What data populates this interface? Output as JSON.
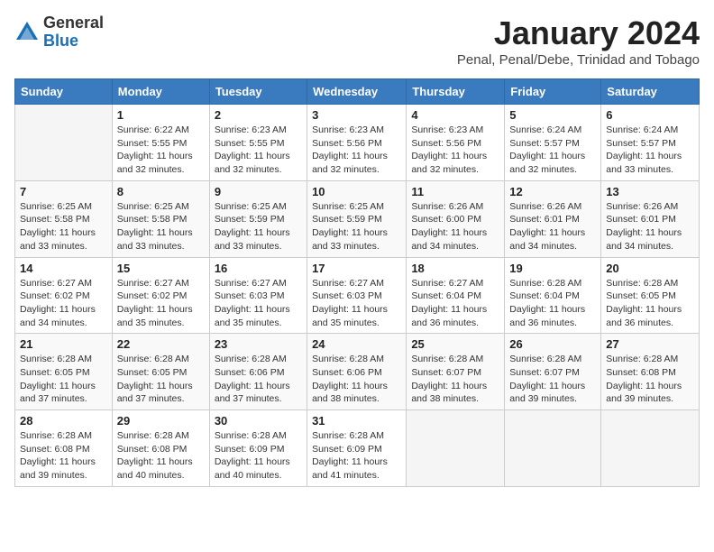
{
  "header": {
    "logo_general": "General",
    "logo_blue": "Blue",
    "month_title": "January 2024",
    "subtitle": "Penal, Penal/Debe, Trinidad and Tobago"
  },
  "days_of_week": [
    "Sunday",
    "Monday",
    "Tuesday",
    "Wednesday",
    "Thursday",
    "Friday",
    "Saturday"
  ],
  "weeks": [
    [
      {
        "day": "",
        "info": ""
      },
      {
        "day": "1",
        "info": "Sunrise: 6:22 AM\nSunset: 5:55 PM\nDaylight: 11 hours and 32 minutes."
      },
      {
        "day": "2",
        "info": "Sunrise: 6:23 AM\nSunset: 5:55 PM\nDaylight: 11 hours and 32 minutes."
      },
      {
        "day": "3",
        "info": "Sunrise: 6:23 AM\nSunset: 5:56 PM\nDaylight: 11 hours and 32 minutes."
      },
      {
        "day": "4",
        "info": "Sunrise: 6:23 AM\nSunset: 5:56 PM\nDaylight: 11 hours and 32 minutes."
      },
      {
        "day": "5",
        "info": "Sunrise: 6:24 AM\nSunset: 5:57 PM\nDaylight: 11 hours and 32 minutes."
      },
      {
        "day": "6",
        "info": "Sunrise: 6:24 AM\nSunset: 5:57 PM\nDaylight: 11 hours and 33 minutes."
      }
    ],
    [
      {
        "day": "7",
        "info": "Sunrise: 6:25 AM\nSunset: 5:58 PM\nDaylight: 11 hours and 33 minutes."
      },
      {
        "day": "8",
        "info": "Sunrise: 6:25 AM\nSunset: 5:58 PM\nDaylight: 11 hours and 33 minutes."
      },
      {
        "day": "9",
        "info": "Sunrise: 6:25 AM\nSunset: 5:59 PM\nDaylight: 11 hours and 33 minutes."
      },
      {
        "day": "10",
        "info": "Sunrise: 6:25 AM\nSunset: 5:59 PM\nDaylight: 11 hours and 33 minutes."
      },
      {
        "day": "11",
        "info": "Sunrise: 6:26 AM\nSunset: 6:00 PM\nDaylight: 11 hours and 34 minutes."
      },
      {
        "day": "12",
        "info": "Sunrise: 6:26 AM\nSunset: 6:01 PM\nDaylight: 11 hours and 34 minutes."
      },
      {
        "day": "13",
        "info": "Sunrise: 6:26 AM\nSunset: 6:01 PM\nDaylight: 11 hours and 34 minutes."
      }
    ],
    [
      {
        "day": "14",
        "info": "Sunrise: 6:27 AM\nSunset: 6:02 PM\nDaylight: 11 hours and 34 minutes."
      },
      {
        "day": "15",
        "info": "Sunrise: 6:27 AM\nSunset: 6:02 PM\nDaylight: 11 hours and 35 minutes."
      },
      {
        "day": "16",
        "info": "Sunrise: 6:27 AM\nSunset: 6:03 PM\nDaylight: 11 hours and 35 minutes."
      },
      {
        "day": "17",
        "info": "Sunrise: 6:27 AM\nSunset: 6:03 PM\nDaylight: 11 hours and 35 minutes."
      },
      {
        "day": "18",
        "info": "Sunrise: 6:27 AM\nSunset: 6:04 PM\nDaylight: 11 hours and 36 minutes."
      },
      {
        "day": "19",
        "info": "Sunrise: 6:28 AM\nSunset: 6:04 PM\nDaylight: 11 hours and 36 minutes."
      },
      {
        "day": "20",
        "info": "Sunrise: 6:28 AM\nSunset: 6:05 PM\nDaylight: 11 hours and 36 minutes."
      }
    ],
    [
      {
        "day": "21",
        "info": "Sunrise: 6:28 AM\nSunset: 6:05 PM\nDaylight: 11 hours and 37 minutes."
      },
      {
        "day": "22",
        "info": "Sunrise: 6:28 AM\nSunset: 6:05 PM\nDaylight: 11 hours and 37 minutes."
      },
      {
        "day": "23",
        "info": "Sunrise: 6:28 AM\nSunset: 6:06 PM\nDaylight: 11 hours and 37 minutes."
      },
      {
        "day": "24",
        "info": "Sunrise: 6:28 AM\nSunset: 6:06 PM\nDaylight: 11 hours and 38 minutes."
      },
      {
        "day": "25",
        "info": "Sunrise: 6:28 AM\nSunset: 6:07 PM\nDaylight: 11 hours and 38 minutes."
      },
      {
        "day": "26",
        "info": "Sunrise: 6:28 AM\nSunset: 6:07 PM\nDaylight: 11 hours and 39 minutes."
      },
      {
        "day": "27",
        "info": "Sunrise: 6:28 AM\nSunset: 6:08 PM\nDaylight: 11 hours and 39 minutes."
      }
    ],
    [
      {
        "day": "28",
        "info": "Sunrise: 6:28 AM\nSunset: 6:08 PM\nDaylight: 11 hours and 39 minutes."
      },
      {
        "day": "29",
        "info": "Sunrise: 6:28 AM\nSunset: 6:08 PM\nDaylight: 11 hours and 40 minutes."
      },
      {
        "day": "30",
        "info": "Sunrise: 6:28 AM\nSunset: 6:09 PM\nDaylight: 11 hours and 40 minutes."
      },
      {
        "day": "31",
        "info": "Sunrise: 6:28 AM\nSunset: 6:09 PM\nDaylight: 11 hours and 41 minutes."
      },
      {
        "day": "",
        "info": ""
      },
      {
        "day": "",
        "info": ""
      },
      {
        "day": "",
        "info": ""
      }
    ]
  ]
}
